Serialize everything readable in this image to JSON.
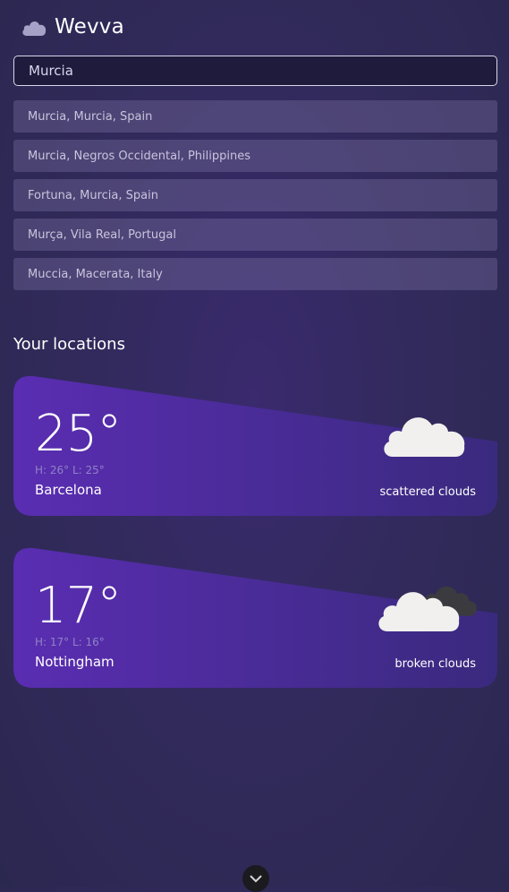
{
  "app": {
    "title": "Wevva"
  },
  "search": {
    "value": "Murcia"
  },
  "suggestions": [
    "Murcia, Murcia, Spain",
    "Murcia, Negros Occidental, Philippines",
    "Fortuna, Murcia, Spain",
    "Murça, Vila Real, Portugal",
    "Muccia, Macerata, Italy"
  ],
  "locations_title": "Your locations",
  "locations": [
    {
      "temp": "25°",
      "hilo": "H: 26° L: 25°",
      "city": "Barcelona",
      "condition": "scattered clouds",
      "icon": "scattered-clouds-icon"
    },
    {
      "temp": "17°",
      "hilo": "H: 17° L: 16°",
      "city": "Nottingham",
      "condition": "broken clouds",
      "icon": "broken-clouds-icon"
    }
  ],
  "colors": {
    "card_start": "#5a2db2",
    "card_end": "#3a2a7e",
    "background": "#322a5c"
  }
}
